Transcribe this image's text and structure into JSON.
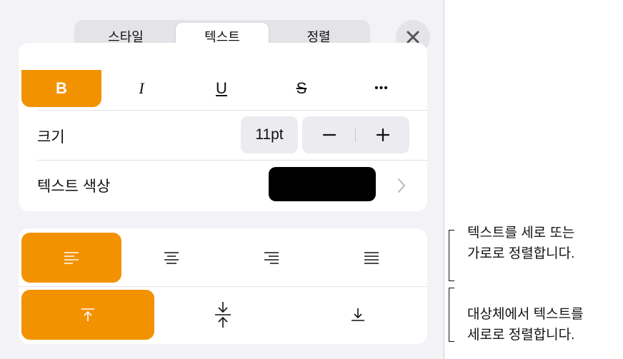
{
  "tabs": [
    {
      "label": "스타일",
      "active": false
    },
    {
      "label": "텍스트",
      "active": true
    },
    {
      "label": "정렬",
      "active": false
    }
  ],
  "format_buttons": [
    {
      "label": "B",
      "name": "bold-button",
      "active": true
    },
    {
      "label": "I",
      "name": "italic-button",
      "active": false
    },
    {
      "label": "U",
      "name": "underline-button",
      "active": false
    },
    {
      "label": "S",
      "name": "strikethrough-button",
      "active": false
    },
    {
      "label": "•••",
      "name": "more-options-button",
      "active": false
    }
  ],
  "size": {
    "label": "크기",
    "value": "11pt",
    "decrement": "−",
    "increment": "+"
  },
  "text_color": {
    "label": "텍스트 색상",
    "color": "#000000"
  },
  "align_buttons": [
    {
      "icon": "align-left-icon",
      "active": true
    },
    {
      "icon": "align-center-icon",
      "active": false
    },
    {
      "icon": "align-right-icon",
      "active": false
    },
    {
      "icon": "align-justify-icon",
      "active": false
    }
  ],
  "vertical_buttons": [
    {
      "icon": "align-top-icon",
      "active": true
    },
    {
      "icon": "align-middle-icon",
      "active": false
    },
    {
      "icon": "align-bottom-icon",
      "active": false
    }
  ],
  "callouts": {
    "horizontal": {
      "line1": "텍스트를 세로 또는",
      "line2": "가로로 정렬합니다."
    },
    "vertical": {
      "line1": "대상체에서 텍스트를",
      "line2": "세로로 정렬합니다."
    }
  },
  "colors": {
    "accent": "#f39200",
    "panel": "#f2f2f7"
  }
}
